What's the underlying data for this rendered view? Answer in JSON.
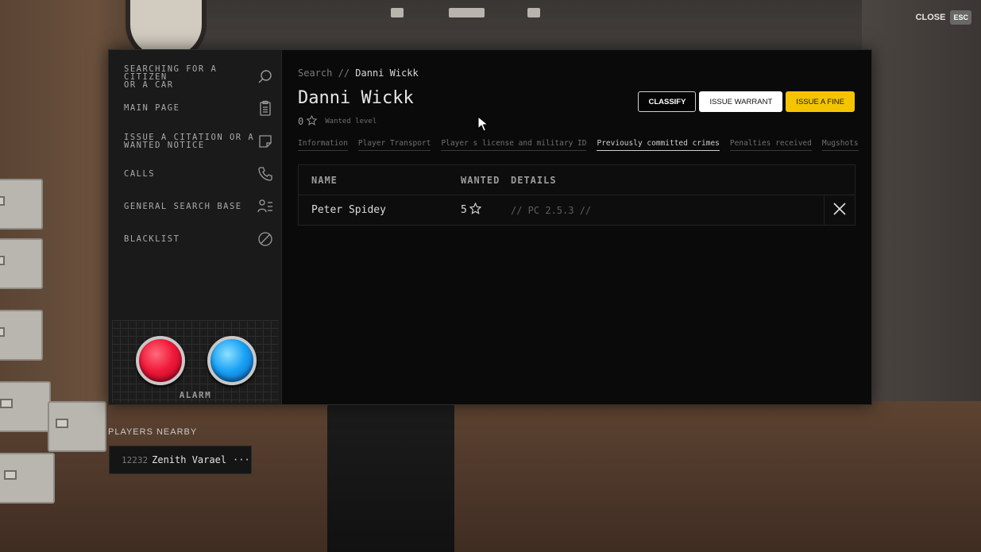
{
  "header": {
    "close_label": "CLOSE",
    "esc_label": "ESC"
  },
  "sidebar": {
    "items": [
      {
        "line1": "SEARCHING FOR A",
        "line2": "CITIZEN",
        "line3": "OR A CAR",
        "icon": "search-icon"
      },
      {
        "label": "MAIN PAGE",
        "icon": "clipboard-icon"
      },
      {
        "line1": "ISSUE A CITATION OR A",
        "line2": "WANTED NOTICE",
        "icon": "sticky-note-icon"
      },
      {
        "label": "CALLS",
        "icon": "phone-icon"
      },
      {
        "label": "GENERAL SEARCH BASE",
        "icon": "person-list-icon"
      },
      {
        "label": "BLACKLIST",
        "icon": "ban-icon"
      }
    ],
    "alarm_label": "ALARM"
  },
  "content": {
    "breadcrumb_root": "Search",
    "breadcrumb_separator": "//",
    "breadcrumb_current": "Danni Wickk",
    "title": "Danni Wickk",
    "wanted_value": "0",
    "wanted_caption": "Wanted level",
    "actions": {
      "classify": "CLASSIFY",
      "warrant": "ISSUE WARRANT",
      "fine": "ISSUE A FINE"
    },
    "tabs": [
      {
        "label": "Information"
      },
      {
        "label": "Player Transport"
      },
      {
        "label": "Player s license and military ID"
      },
      {
        "label": "Previously committed crimes"
      },
      {
        "label": "Penalties received"
      },
      {
        "label": "Mugshots"
      }
    ],
    "active_tab": "Previously committed crimes",
    "table": {
      "headers": {
        "name": "NAME",
        "wanted": "WANTED",
        "details": "DETAILS"
      },
      "rows": [
        {
          "name": "Peter Spidey",
          "wanted": "5",
          "details": "// PC 2.5.3 //"
        }
      ]
    }
  },
  "nearby": {
    "title": "PLAYERS NEARBY",
    "players": [
      {
        "id": "12232",
        "name": "Zenith Varael",
        "more": "···"
      }
    ]
  },
  "colors": {
    "accent_yellow": "#f5c400",
    "alarm_red": "#f01a3a",
    "alarm_blue": "#1aa3f5"
  }
}
